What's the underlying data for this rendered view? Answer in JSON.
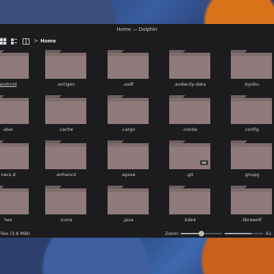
{
  "window": {
    "title": "Home — Dolphin"
  },
  "toolbar": {
    "breadcrumb_separator": ">",
    "location": "Home"
  },
  "folders": [
    "android",
    ".antigen",
    ".asdf",
    ".audacity-data",
    ".byobu",
    "abai",
    ".cache",
    ".cargo",
    ".conda",
    ".config",
    "nacs.d",
    ".enhancd",
    ".epsxe",
    ".git",
    ".gnupg",
    "hex",
    ".icons",
    ".java",
    ".kde4",
    ".librewolf"
  ],
  "status": {
    "summary": "Files (3.8 MiB)",
    "zoom_label": "Zoom:",
    "free_space": "61."
  },
  "zoom": {
    "level_fraction": 0.5
  },
  "space": {
    "used_fraction": 0.7
  },
  "colors": {
    "folder_body": "#8f7b7b",
    "folder_tab": "#6e5e5e",
    "window_bg": "#1c1c1f"
  }
}
